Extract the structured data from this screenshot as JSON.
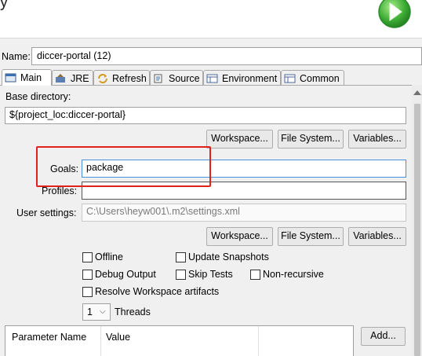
{
  "header": {
    "title_fragment": "y",
    "run_icon": "run-play-icon"
  },
  "name": {
    "label": "Name:",
    "value": "diccer-portal (12)"
  },
  "tabs": [
    {
      "label": "Main",
      "icon": "main-tab-icon"
    },
    {
      "label": "JRE",
      "icon": "jre-icon"
    },
    {
      "label": "Refresh",
      "icon": "refresh-icon"
    },
    {
      "label": "Source",
      "icon": "source-icon"
    },
    {
      "label": "Environment",
      "icon": "environment-icon"
    },
    {
      "label": "Common",
      "icon": "common-icon"
    }
  ],
  "main": {
    "base_directory_label": "Base directory:",
    "base_directory_value": "${project_loc:diccer-portal}",
    "workspace_button": "Workspace...",
    "filesystem_button": "File System...",
    "variables_button": "Variables...",
    "goals_label": "Goals:",
    "goals_value": "package",
    "profiles_label": "Profiles:",
    "profiles_value": "",
    "user_settings_label": "User settings:",
    "user_settings_value": "C:\\Users\\heyw001\\.m2\\settings.xml",
    "workspace_button2": "Workspace...",
    "filesystem_button2": "File System...",
    "variables_button2": "Variables...",
    "options": {
      "offline": "Offline",
      "update_snapshots": "Update Snapshots",
      "debug_output": "Debug Output",
      "skip_tests": "Skip Tests",
      "non_recursive": "Non-recursive",
      "resolve_workspace": "Resolve Workspace artifacts"
    },
    "threads_value": "1",
    "threads_label": "Threads",
    "table_headers": [
      "Parameter Name",
      "Value"
    ],
    "add_button": "Add..."
  },
  "colors": {
    "highlight": "#e0221b",
    "run_icon": "#3aa33a"
  }
}
